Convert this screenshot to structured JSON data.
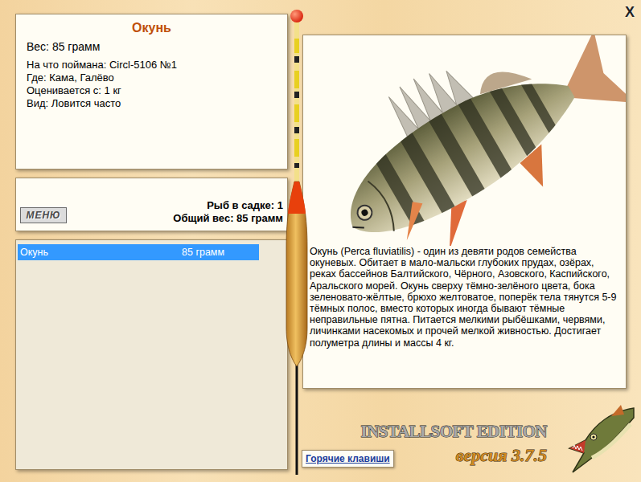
{
  "close": "X",
  "fish": {
    "name": "Окунь",
    "weight": "Вес: 85 грамм",
    "details": [
      "На что поймана: Circl-5106 №1",
      "Где: Кама, Галёво",
      "Оценивается с: 1 кг",
      "Вид: Ловится часто"
    ]
  },
  "menu_button": "МЕНЮ",
  "keepnet": {
    "count": "Рыб в садке: 1",
    "total": "Общий вес: 85 грамм"
  },
  "catch_list": [
    {
      "name": "Окунь",
      "weight": "85 грамм",
      "selected": true
    }
  ],
  "description": "Окунь (Perca fluviatilis) - один из девяти родов семейства окуневых. Обитает в мало-мальски глубоких прудах, озёрах, реках бассейнов Балтийского, Чёрного, Азовского, Каспийского, Аральского морей. Окунь сверху тёмно-зелёного цвета, бока зеленовато-жёлтые, брюхо желтоватое, поперёк тела тянутся 5-9 тёмных полос, вместо которых иногда бывают тёмные неправильные пятна. Питается мелкими рыбёшками, червями, личинками насекомых и прочей мелкой живностью. Достигает полуметра длины и массы 4 кг.",
  "hotkeys_button": "Горячие клавиши",
  "brand": {
    "title": "INSTALLSOFT EDITION",
    "version": "версия 3.7.5"
  }
}
